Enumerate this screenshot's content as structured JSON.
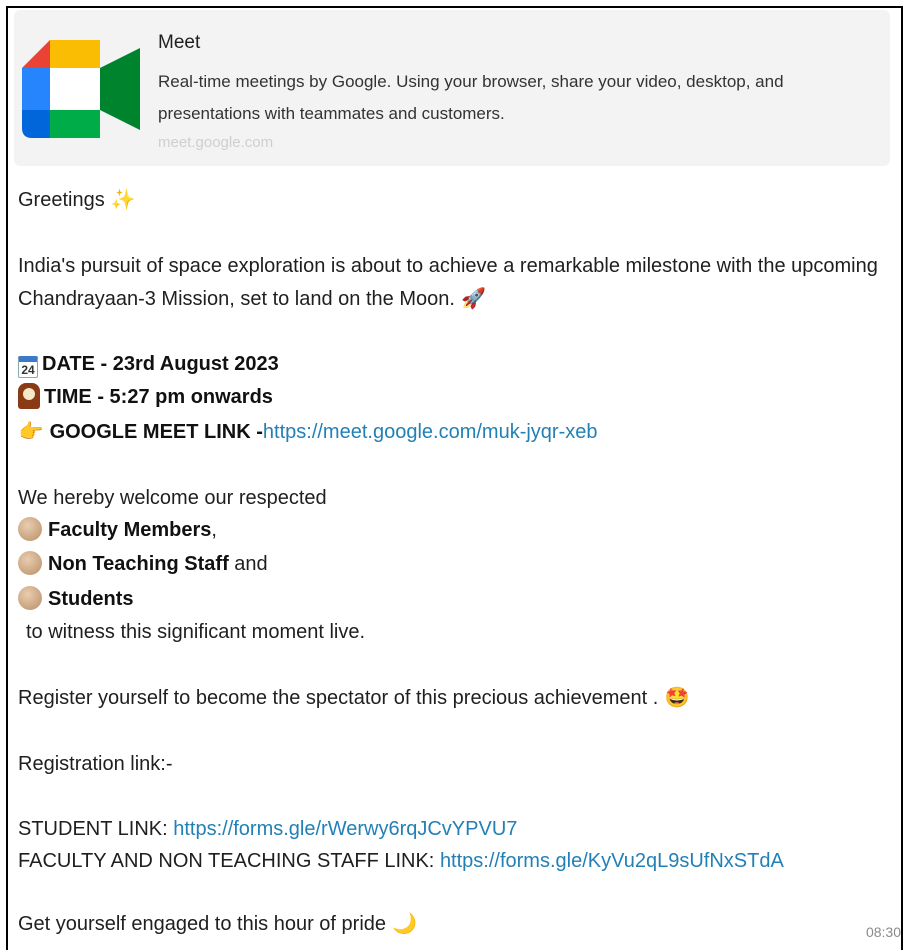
{
  "preview": {
    "title": "Meet",
    "description": "Real-time meetings by Google. Using your browser, share your video, desktop, and presentations with teammates and customers.",
    "domain": "meet.google.com"
  },
  "message": {
    "greeting": "Greetings",
    "intro_1": "India's pursuit of space exploration is about to achieve a remarkable milestone with the upcoming",
    "intro_2": "Chandrayaan-3 Mission, set to land on the Moon.",
    "calendar_day": "24",
    "date": "DATE - 23rd August 2023",
    "time": "TIME - 5:27 pm onwards",
    "meet_label": "GOOGLE MEET LINK -",
    "meet_link": "https://meet.google.com/muk-jyqr-xeb",
    "welcome": "We hereby welcome our respected",
    "faculty": "Faculty Members",
    "faculty_suffix": ",",
    "staff": "Non Teaching Staff",
    "staff_suffix": " and",
    "students": "Students",
    "witness": "to witness this significant moment live.",
    "register": "Register yourself to become the spectator of this precious achievement .",
    "registration_label": "Registration link:-",
    "student_label": "STUDENT LINK: ",
    "student_link": "https://forms.gle/rWerwy6rqJCvYPVU7",
    "faculty_label": "FACULTY AND NON TEACHING STAFF LINK: ",
    "faculty_link": "https://forms.gle/KyVu2qL9sUfNxSTdA",
    "closing": "Get yourself engaged to this hour of pride",
    "timestamp": "08:30"
  },
  "icons": [
    "google-meet-logo",
    "sparkles-icon",
    "rocket-icon",
    "calendar-icon",
    "clock-icon",
    "pointing-hand-icon",
    "moon-icon",
    "face-icon",
    "moon-crescent-icon"
  ]
}
